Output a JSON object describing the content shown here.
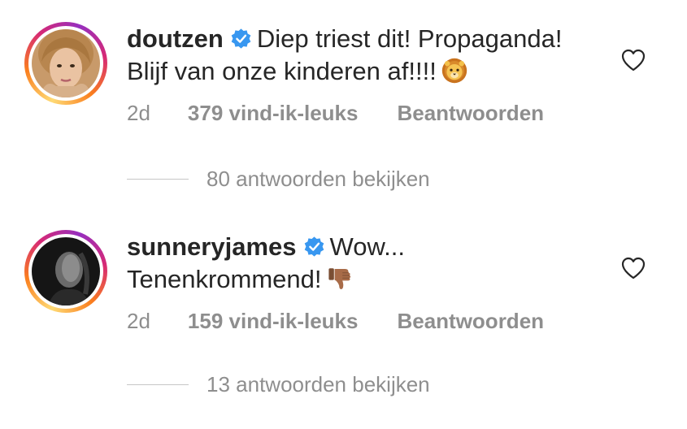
{
  "comments": [
    {
      "username": "doutzen",
      "verified": true,
      "line1": "Diep triest dit! Propaganda!",
      "line2": "Blijf van onze kinderen af!!!!",
      "emoji": "lion-face-emoji",
      "time": "2d",
      "likes": "379 vind-ik-leuks",
      "reply_label": "Beantwoorden",
      "view_replies": "80 antwoorden bekijken",
      "liked": false
    },
    {
      "username": "sunneryjames",
      "verified": true,
      "line1": "Wow...",
      "line2": "Tenenkrommend!",
      "emoji": "thumbs-down-emoji",
      "time": "2d",
      "likes": "159 vind-ik-leuks",
      "reply_label": "Beantwoorden",
      "view_replies": "13 antwoorden bekijken",
      "liked": false
    }
  ],
  "colors": {
    "text": "#262626",
    "secondary": "#8e8e8e",
    "verified": "#3897f0",
    "divider": "#c7c7c7"
  }
}
